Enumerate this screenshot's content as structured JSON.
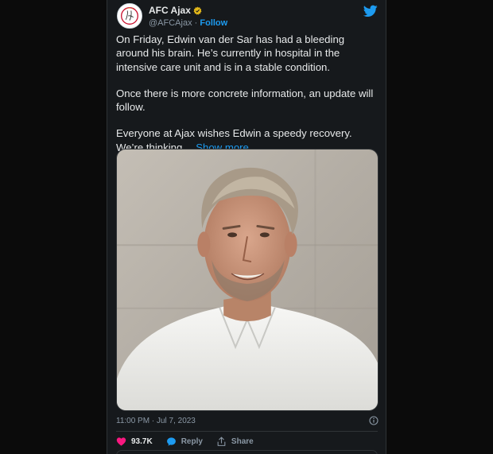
{
  "account": {
    "display_name": "AFC Ajax",
    "handle": "@AFCAjax",
    "separator": "·",
    "follow_label": "Follow",
    "verified_badge": "gold-verified-badge-icon",
    "avatar_icon": "ajax-crest-icon"
  },
  "platform_icon": "twitter-bird-icon",
  "tweet": {
    "paragraphs": [
      "On Friday, Edwin van der Sar has had a bleeding around his brain. He’s currently in hospital in the intensive care unit and is in a stable condition.",
      "Once there is more concrete information, an update will follow.",
      "Everyone at Ajax wishes Edwin a speedy recovery. We’re thinking…"
    ],
    "show_more_label": "Show more",
    "timestamp": "11:00 PM · Jul 7, 2023"
  },
  "actions": {
    "likes": "93.7K",
    "reply_label": "Reply",
    "share_label": "Share"
  },
  "colors": {
    "background": "#16191c",
    "text": "#e7e9ea",
    "muted": "#8b98a5",
    "accent": "#1d9bf0",
    "like": "#f91880",
    "badge": "#e2b719"
  }
}
